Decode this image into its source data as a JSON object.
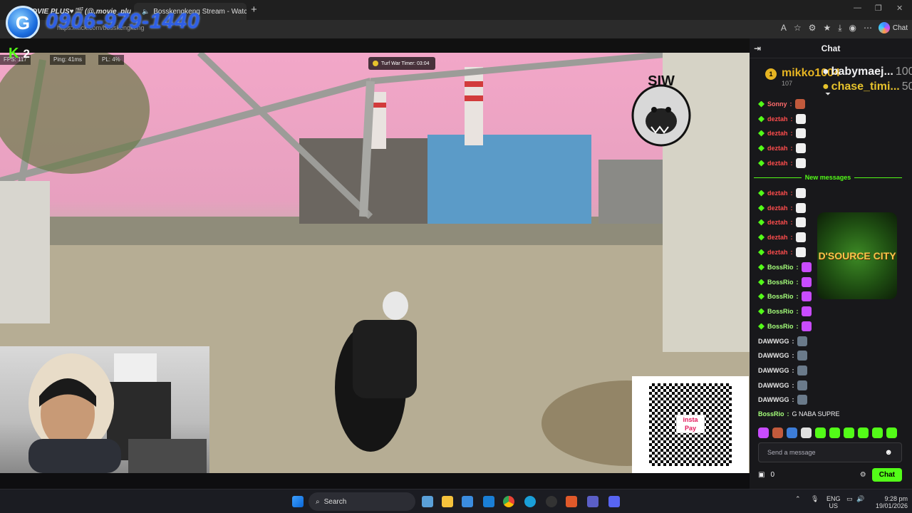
{
  "browser": {
    "tabs": [
      {
        "title": "MOVIE PLUS♥🎬 (@.movie_plu",
        "close": "✕"
      },
      {
        "title": "Bosskengkeng Stream - Watch",
        "close": "✕"
      }
    ],
    "new_tab": "+",
    "url": "https://kick.com/bosskengkeng",
    "copilot_label": "Chat",
    "window_controls": [
      "—",
      "❐",
      "✕"
    ]
  },
  "overlay": {
    "logo_letter": "G",
    "phone": "0906-979-1440"
  },
  "stream": {
    "platform_badge": "K",
    "viewer_count": "2",
    "hud": {
      "fps": "FPS: 117",
      "ping": "Ping: 41ms",
      "pl": "PL: 4%"
    },
    "turf_timer": "Turf War Timer: 03:04",
    "siw_logo": "SIW",
    "qr_brand": "insta Pay"
  },
  "chat": {
    "title": "Chat",
    "leaderboard": [
      {
        "rank": "1",
        "name": "mikko1004",
        "points": "107"
      },
      {
        "name": "babymaej...",
        "points": "100"
      },
      {
        "name": "chase_timi...",
        "points": "50"
      }
    ],
    "new_messages_label": "New messages",
    "messages": [
      {
        "user": "Sonny",
        "color": "#ff6b6b"
      },
      {
        "user": "deztah",
        "color": "#ff4d4d"
      },
      {
        "user": "deztah",
        "color": "#ff4d4d"
      },
      {
        "user": "deztah",
        "color": "#ff4d4d"
      },
      {
        "user": "deztah",
        "color": "#ff4d4d"
      },
      {
        "user": "deztah",
        "color": "#ff4d4d"
      },
      {
        "user": "deztah",
        "color": "#ff4d4d"
      },
      {
        "user": "deztah",
        "color": "#ff4d4d"
      },
      {
        "user": "deztah",
        "color": "#ff4d4d"
      },
      {
        "user": "deztah",
        "color": "#ff4d4d"
      },
      {
        "user": "BossRio",
        "color": "#a5ff7a"
      },
      {
        "user": "BossRio",
        "color": "#a5ff7a"
      },
      {
        "user": "BossRio",
        "color": "#a5ff7a"
      },
      {
        "user": "BossRio",
        "color": "#a5ff7a"
      },
      {
        "user": "BossRio",
        "color": "#a5ff7a"
      },
      {
        "user": "DAWWGG",
        "color": "#e6e6e6"
      },
      {
        "user": "DAWWGG",
        "color": "#e6e6e6"
      },
      {
        "user": "DAWWGG",
        "color": "#e6e6e6"
      },
      {
        "user": "DAWWGG",
        "color": "#e6e6e6"
      },
      {
        "user": "DAWWGG",
        "color": "#e6e6e6"
      }
    ],
    "last_message": {
      "user": "BossRio",
      "text": "G NABA SUPRE"
    },
    "sponsor_logo": "D'SOURCE CITY",
    "input_placeholder": "Send a message",
    "foot_count": "0",
    "send_label": "Chat"
  },
  "taskbar": {
    "search_label": "Search",
    "lang_top": "ENG",
    "lang_bottom": "US",
    "time": "9:28 pm",
    "date": "19/01/2026"
  }
}
